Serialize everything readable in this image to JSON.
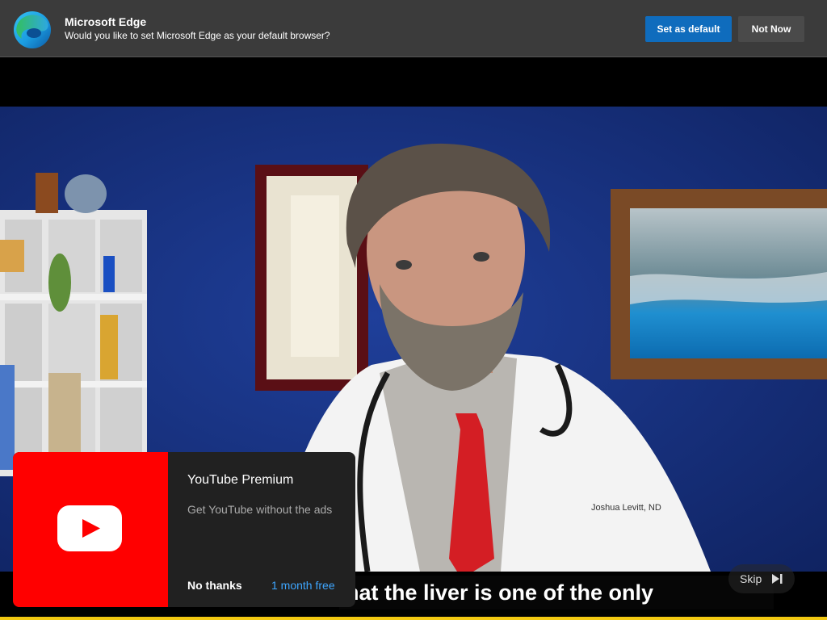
{
  "edge_banner": {
    "title": "Microsoft Edge",
    "message": "Would you like to set Microsoft Edge as your default browser?",
    "set_default_label": "Set as default",
    "not_now_label": "Not Now"
  },
  "video": {
    "caption": "hat the liver is one of the only",
    "skip_label": "Skip",
    "coat_text": "Joshua Levitt, ND"
  },
  "premium_promo": {
    "title": "YouTube Premium",
    "subtitle": "Get YouTube without the ads",
    "no_thanks_label": "No thanks",
    "trial_label": "1 month free"
  },
  "colors": {
    "edge_primary": "#0f6cbd",
    "youtube_red": "#ff0000",
    "link_blue": "#3ea6ff",
    "progress_yellow": "#f2c811"
  },
  "icons": [
    "edge-logo-icon",
    "skip-icon",
    "youtube-play-icon"
  ]
}
